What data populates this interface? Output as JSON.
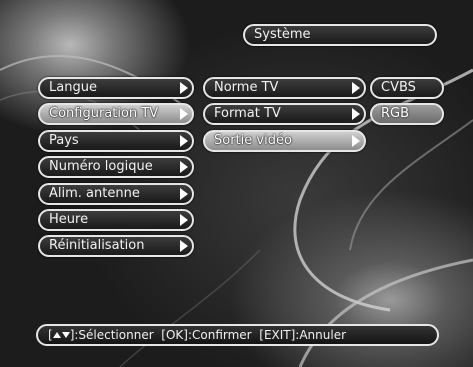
{
  "title": "Système",
  "menu": [
    {
      "label": "Langue",
      "state": "normal"
    },
    {
      "label": "Configuration TV",
      "state": "selected"
    },
    {
      "label": "Pays",
      "state": "normal"
    },
    {
      "label": "Numéro logique",
      "state": "normal"
    },
    {
      "label": "Alim. antenne",
      "state": "normal"
    },
    {
      "label": "Heure",
      "state": "normal"
    },
    {
      "label": "Réinitialisation",
      "state": "normal"
    }
  ],
  "submenu": [
    {
      "label": "Norme TV",
      "state": "normal"
    },
    {
      "label": "Format TV",
      "state": "normal"
    },
    {
      "label": "Sortie vidéo",
      "state": "selected"
    }
  ],
  "options": [
    {
      "label": "CVBS",
      "state": "normal"
    },
    {
      "label": "RGB",
      "state": "selected"
    }
  ],
  "footer": {
    "open_bracket": "[",
    "select": "]:Sélectionner",
    "ok": "[OK]:Confirmer",
    "exit": "[EXIT]:Annuler"
  },
  "icons": {
    "arrow": "right-triangle",
    "nav": "up-down-triangles"
  }
}
